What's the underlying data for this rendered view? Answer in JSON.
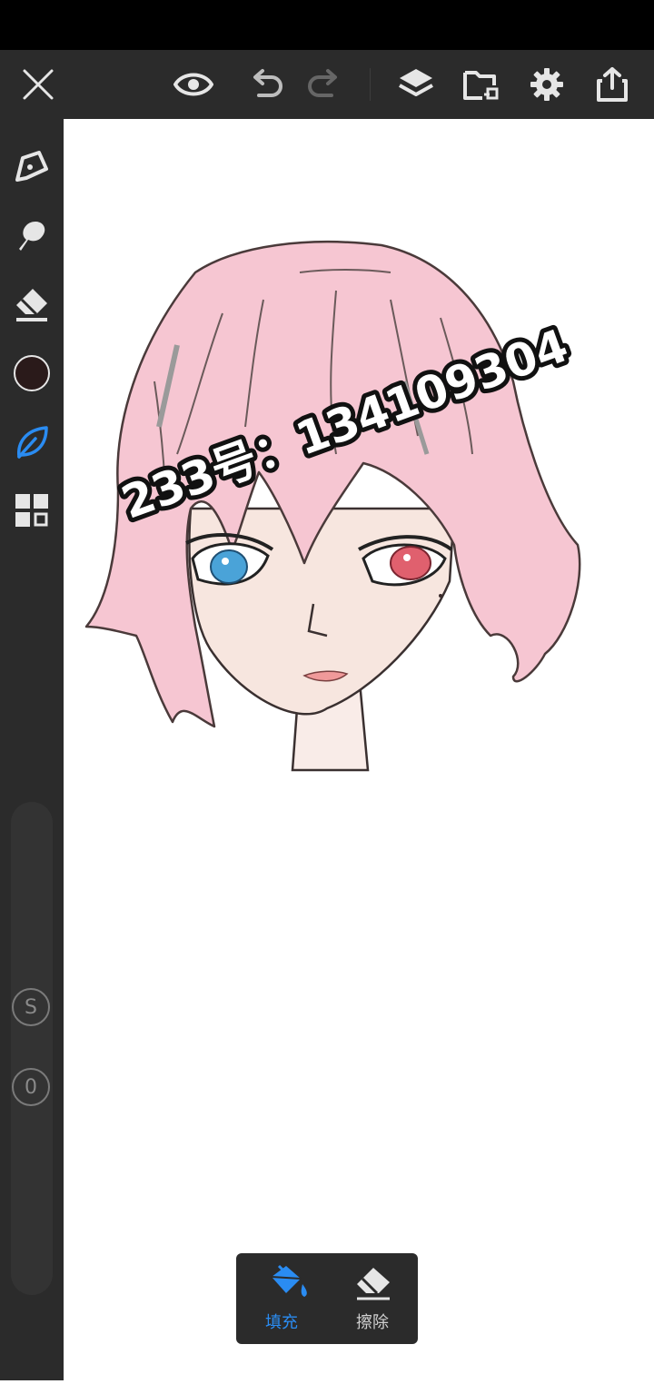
{
  "toolbar": {
    "close_icon": "close-icon",
    "visibility_icon": "eye-icon",
    "undo_icon": "undo-icon",
    "redo_icon": "redo-icon",
    "layers_icon": "layers-icon",
    "import_icon": "folder-import-icon",
    "settings_icon": "gear-icon",
    "share_icon": "share-icon"
  },
  "sidebar": {
    "tools": [
      "pen-icon",
      "smudge-icon",
      "eraser-icon",
      "color-swatch",
      "leaf-brush-icon",
      "grid-icon"
    ],
    "active_tool": "leaf-brush-icon",
    "current_color": "#2a1a1a",
    "size_label": "S",
    "opacity_label": "0"
  },
  "canvas": {
    "watermark_text": "233号：134109304"
  },
  "fill_panel": {
    "fill_label": "填充",
    "erase_label": "擦除",
    "active": "fill"
  },
  "colors": {
    "accent": "#2a8cf2",
    "toolbar_bg": "#2b2b2b",
    "hair": "#f6c6d2",
    "skin": "#f7e6df",
    "left_eye": "#4aa3d8",
    "right_eye": "#e0606e"
  }
}
